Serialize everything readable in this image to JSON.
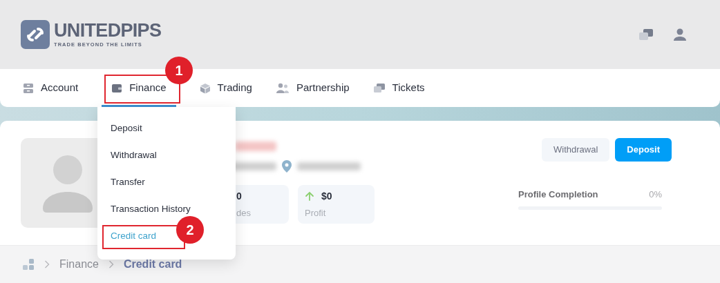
{
  "brand": {
    "name": "UNITEDPIPS",
    "tagline": "TRADE BEYOND THE LIMITS"
  },
  "nav": [
    {
      "label": "Account",
      "selected": false
    },
    {
      "label": "Finance",
      "selected": true
    },
    {
      "label": "Trading",
      "selected": false
    },
    {
      "label": "Partnership",
      "selected": false
    },
    {
      "label": "Tickets",
      "selected": false
    }
  ],
  "finance_menu": [
    {
      "label": "Deposit",
      "selected": false
    },
    {
      "label": "Withdrawal",
      "selected": false
    },
    {
      "label": "Transfer",
      "selected": false
    },
    {
      "label": "Transaction History",
      "selected": false
    },
    {
      "label": "Credit card",
      "selected": true
    }
  ],
  "profile": {
    "stats": [
      {
        "value": "0",
        "label": "des"
      },
      {
        "value": "$0",
        "label": "Profit"
      }
    ],
    "buttons": [
      {
        "label": "Withdrawal",
        "kind": "secondary"
      },
      {
        "label": "Deposit",
        "kind": "primary"
      }
    ],
    "completion": {
      "label": "Profile Completion",
      "reading": "0%",
      "level": 0
    }
  },
  "breadcrumb": [
    "Finance",
    "Credit card"
  ],
  "annotations": [
    {
      "label": "1"
    },
    {
      "label": "2"
    }
  ]
}
